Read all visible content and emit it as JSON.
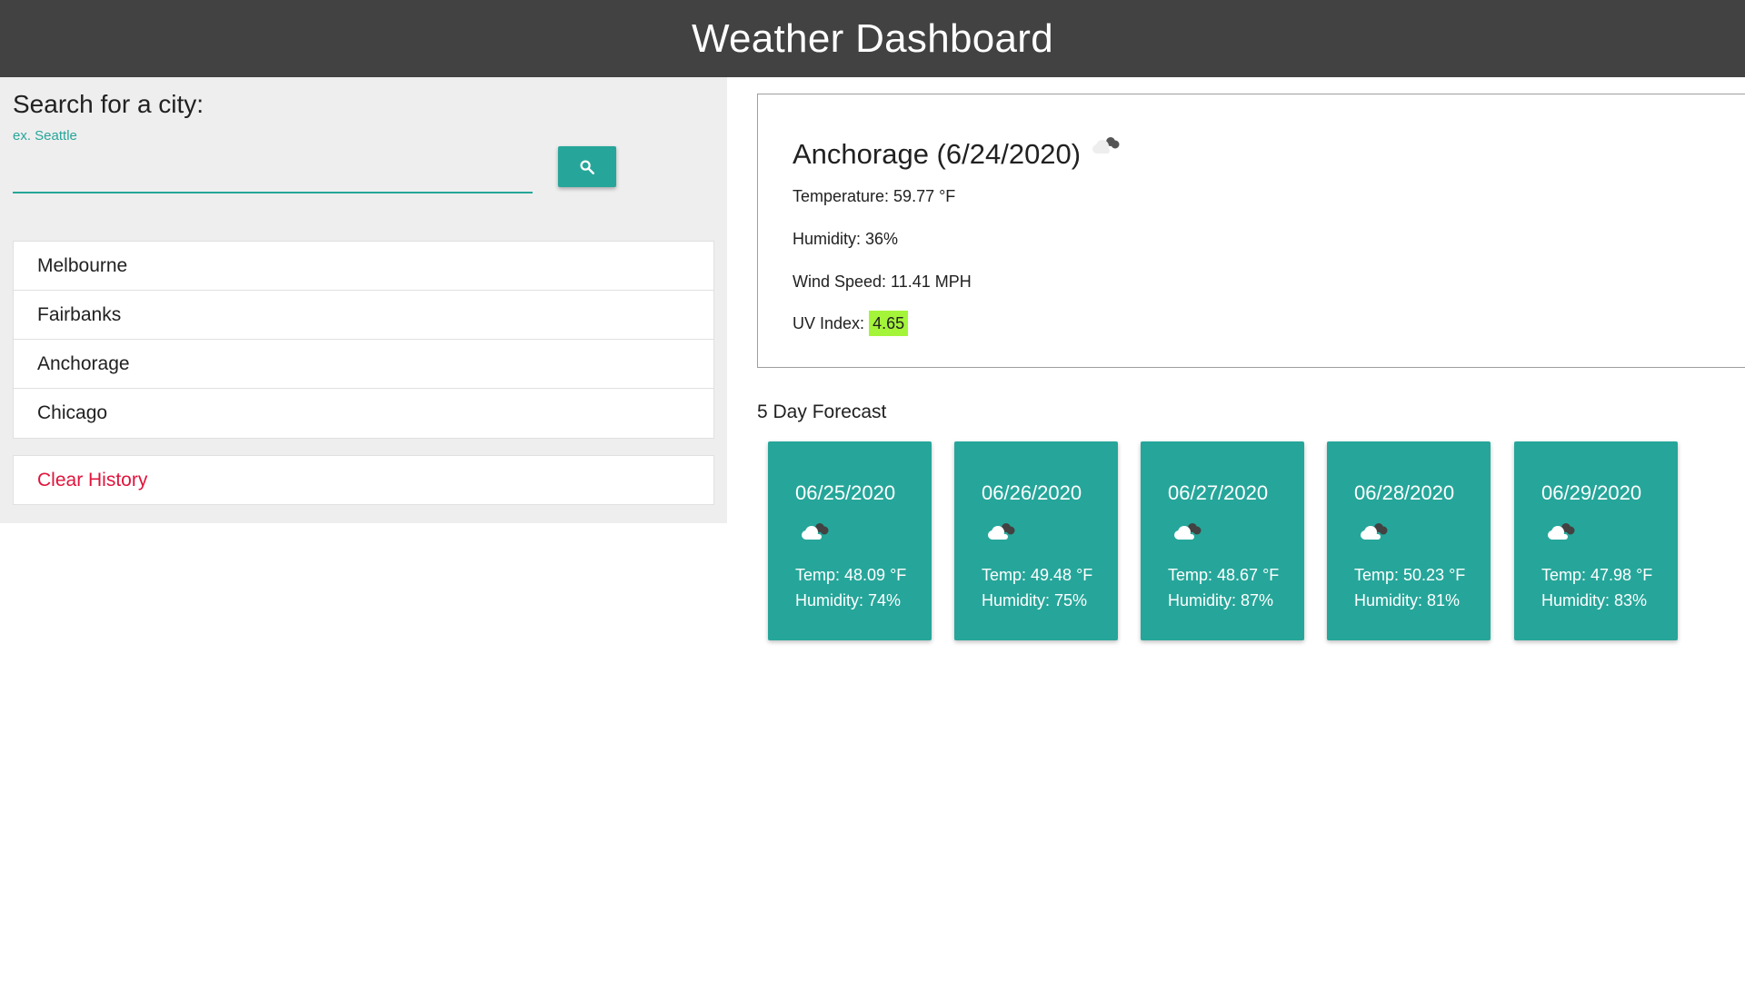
{
  "header": {
    "title": "Weather Dashboard"
  },
  "search": {
    "heading": "Search for a city:",
    "placeholder": "ex. Seattle",
    "value": "",
    "button_icon": "search-icon"
  },
  "history": {
    "items": [
      {
        "label": "Melbourne"
      },
      {
        "label": "Fairbanks"
      },
      {
        "label": "Anchorage"
      },
      {
        "label": "Chicago"
      }
    ],
    "clear_label": "Clear History"
  },
  "current": {
    "title": "Anchorage (6/24/2020)",
    "icon": "broken-clouds-icon",
    "temperature": "Temperature: 59.77 °F",
    "humidity": "Humidity: 36%",
    "wind": "Wind Speed: 11.41 MPH",
    "uv_label": "UV Index:",
    "uv_value": "4.65",
    "uv_color": "#a4f43a"
  },
  "forecast": {
    "title": "5 Day Forecast",
    "days": [
      {
        "date": "06/25/2020",
        "icon": "broken-clouds-icon",
        "temp": "Temp: 48.09 °F",
        "humidity": "Humidity: 74%"
      },
      {
        "date": "06/26/2020",
        "icon": "broken-clouds-icon",
        "temp": "Temp: 49.48 °F",
        "humidity": "Humidity: 75%"
      },
      {
        "date": "06/27/2020",
        "icon": "broken-clouds-icon",
        "temp": "Temp: 48.67 °F",
        "humidity": "Humidity: 87%"
      },
      {
        "date": "06/28/2020",
        "icon": "broken-clouds-icon",
        "temp": "Temp: 50.23 °F",
        "humidity": "Humidity: 81%"
      },
      {
        "date": "06/29/2020",
        "icon": "broken-clouds-icon",
        "temp": "Temp: 47.98 °F",
        "humidity": "Humidity: 83%"
      }
    ]
  },
  "colors": {
    "header_bg": "#424242",
    "accent": "#26a69a",
    "clear_text": "#e0143c"
  }
}
